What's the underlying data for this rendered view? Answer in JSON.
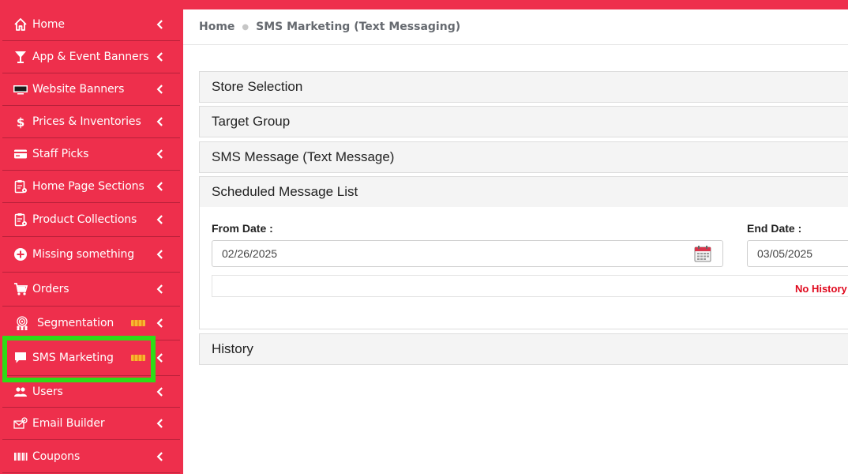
{
  "sidebar": {
    "items": [
      {
        "label": "Home",
        "icon": "home-icon"
      },
      {
        "label": "App & Event Banners",
        "icon": "cocktail-icon"
      },
      {
        "label": "Website Banners",
        "icon": "monitor-icon"
      },
      {
        "label": "Prices & Inventories",
        "icon": "dollar-icon"
      },
      {
        "label": "Staff Picks",
        "icon": "card-icon"
      },
      {
        "label": "Home Page Sections",
        "icon": "clipboard-settings-icon"
      },
      {
        "label": "Product Collections",
        "icon": "clipboard-list-icon"
      },
      {
        "label": "Missing something",
        "icon": "plus-circle-icon"
      },
      {
        "label": "Orders",
        "icon": "cart-icon"
      },
      {
        "label": "Segmentation",
        "icon": "target-people-icon",
        "badge": "new"
      },
      {
        "label": "SMS Marketing",
        "icon": "chat-icon",
        "badge": "new",
        "highlighted": true
      },
      {
        "label": "Users",
        "icon": "users-icon"
      },
      {
        "label": "Email Builder",
        "icon": "email-settings-icon"
      },
      {
        "label": "Coupons",
        "icon": "barcode-icon"
      }
    ]
  },
  "breadcrumb": {
    "home": "Home",
    "current": "SMS Marketing (Text Messaging)"
  },
  "panels": {
    "store_selection": "Store Selection",
    "target_group": "Target Group",
    "sms_message": "SMS Message (Text Message)",
    "scheduled_list": "Scheduled Message List",
    "history": "History"
  },
  "scheduled": {
    "from_label": "From Date :",
    "from_value": "02/26/2025",
    "end_label": "End Date :",
    "end_value": "03/05/2025",
    "empty_message": "No History"
  },
  "colors": {
    "brand": "#ee2f4c",
    "highlight": "#2fdc16",
    "error": "#e0081d"
  }
}
